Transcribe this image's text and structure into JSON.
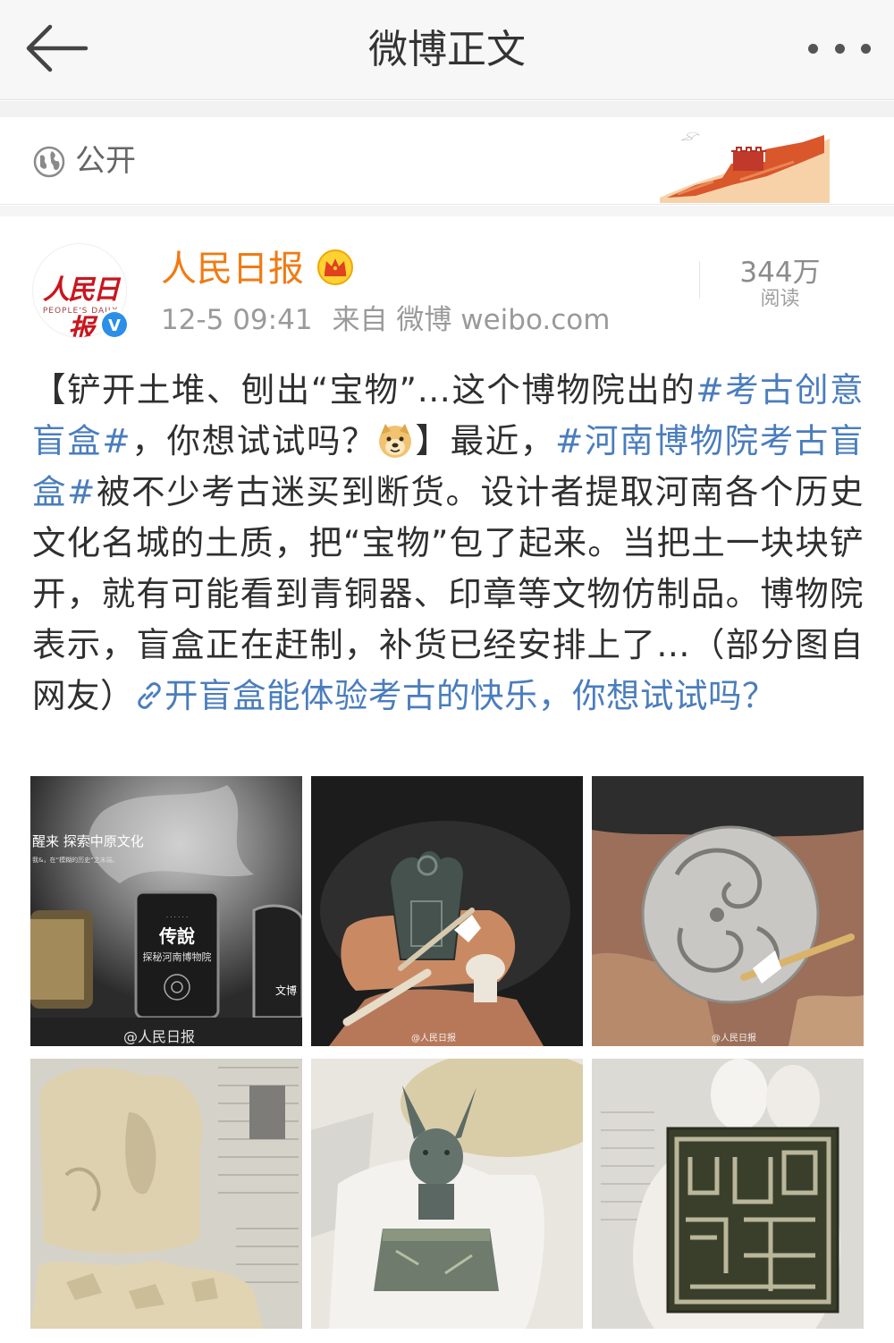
{
  "nav": {
    "title": "微博正文",
    "back_icon": "arrow-left-icon",
    "more_icon": "more-dots-icon"
  },
  "visibility": {
    "icon": "globe-icon",
    "label": "公开"
  },
  "author": {
    "name": "人民日报",
    "avatar_text": "人民日报",
    "avatar_subtext": "PEOPLE'S DAILY",
    "verified_mark": "V",
    "badge_icon": "crown-icon",
    "time": "12-5 09:41",
    "source_prefix": "来自",
    "source": "微博 weibo.com"
  },
  "reads": {
    "count": "344万",
    "label": "阅读"
  },
  "post": {
    "seg1": "【铲开土堆、刨出“宝物”…这个博物院出的",
    "tag1": "#考古创意盲盒#",
    "seg2": "，你想试试吗？",
    "emoji": "doge-emoji",
    "seg3": "】最近，",
    "tag2": "#河南博物院考古盲盒#",
    "seg4": "被不少考古迷买到断货。设计者提取河南各个历史文化名城的土质，把“宝物”包了起来。当把土一块块铲开，就有可能看到青铜器、印章等文物仿制品。博物院表示，盲盒正在赶制，补货已经安排上了…（部分图自网友）",
    "link_icon": "link-icon",
    "link_text": "开盲盒能体验考古的快乐，你想试试吗？"
  },
  "photos": {
    "p1_text": "醒来 探索中原文化",
    "p1_subtext": "我&，在“模糊的历史”之末端。",
    "p1_box_brand": "传說",
    "p1_box_name": "探秘河南博物院",
    "p1_box_right": "文博",
    "watermark_full": "@人民日报",
    "watermark_small": "@人民日报"
  },
  "colors": {
    "accent_orange": "#f07b13",
    "link_blue": "#4a7dbd",
    "verified_blue": "#2b8ee8",
    "brand_red": "#c8161d"
  }
}
